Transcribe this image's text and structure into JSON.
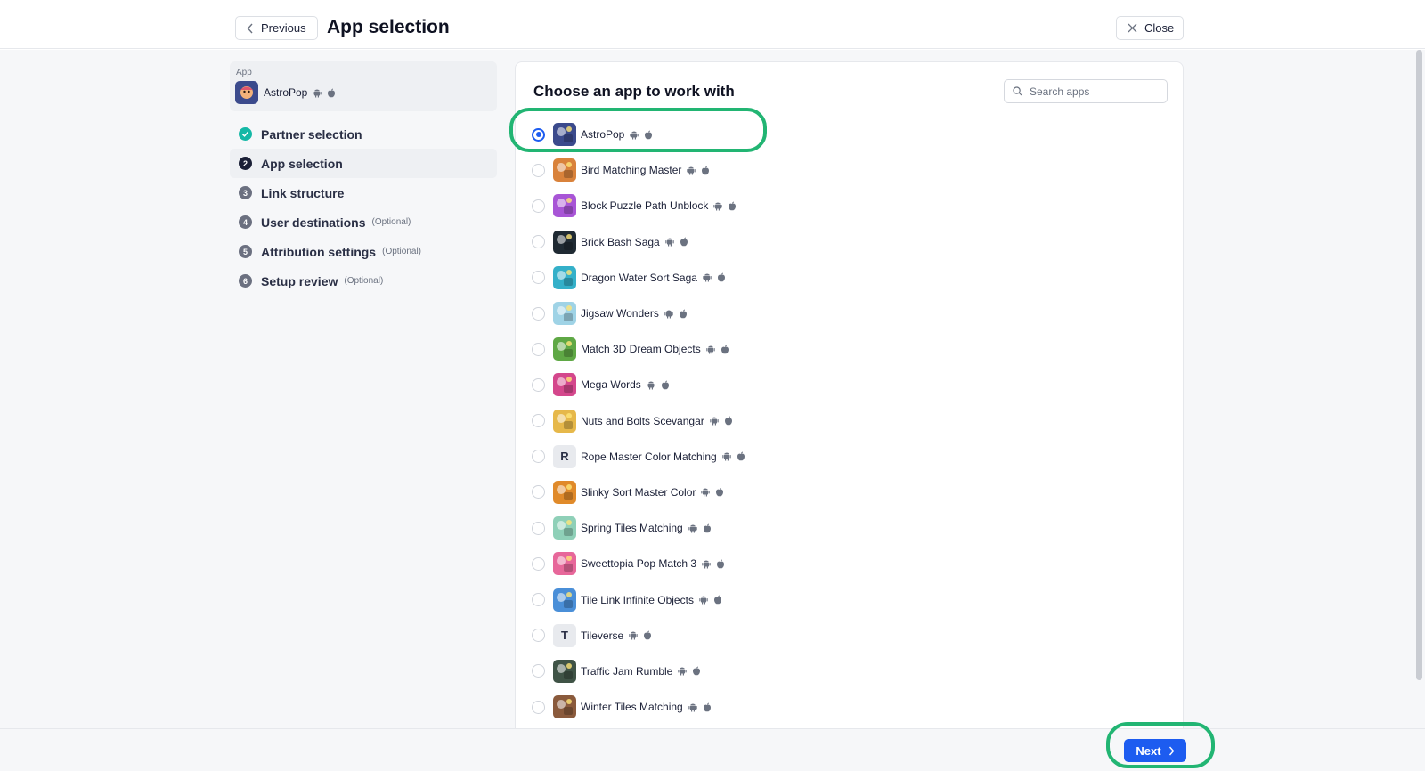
{
  "header": {
    "previous_label": "Previous",
    "title": "App selection",
    "close_label": "Close"
  },
  "sidebar": {
    "app_label": "App",
    "app_name": "AstroPop",
    "steps": [
      {
        "num": "1",
        "label": "Partner selection",
        "optional": "",
        "state": "done"
      },
      {
        "num": "2",
        "label": "App selection",
        "optional": "",
        "state": "active"
      },
      {
        "num": "3",
        "label": "Link structure",
        "optional": "",
        "state": "pending"
      },
      {
        "num": "4",
        "label": "User destinations",
        "optional": "(Optional)",
        "state": "pending"
      },
      {
        "num": "5",
        "label": "Attribution settings",
        "optional": "(Optional)",
        "state": "pending"
      },
      {
        "num": "6",
        "label": "Setup review",
        "optional": "(Optional)",
        "state": "pending"
      }
    ]
  },
  "main": {
    "title": "Choose an app to work with",
    "search_placeholder": "Search apps",
    "apps": [
      {
        "name": "AstroPop",
        "selected": true,
        "icon": "astropop-icon",
        "color": "#3b4a8c"
      },
      {
        "name": "Bird Matching Master",
        "selected": false,
        "icon": "bird-icon",
        "color": "#d9823b"
      },
      {
        "name": "Block Puzzle Path Unblock",
        "selected": false,
        "icon": "block-puzzle-icon",
        "color": "#a855d6"
      },
      {
        "name": "Brick Bash Saga",
        "selected": false,
        "icon": "brick-icon",
        "color": "#1f2a33"
      },
      {
        "name": "Dragon Water Sort Saga",
        "selected": false,
        "icon": "dragon-icon",
        "color": "#34b0c9"
      },
      {
        "name": "Jigsaw Wonders",
        "selected": false,
        "icon": "jigsaw-icon",
        "color": "#9fd3e6"
      },
      {
        "name": "Match 3D Dream Objects",
        "selected": false,
        "icon": "match3d-icon",
        "color": "#5fa845"
      },
      {
        "name": "Mega Words",
        "selected": false,
        "icon": "words-icon",
        "color": "#d4478c"
      },
      {
        "name": "Nuts and Bolts Scevangar",
        "selected": false,
        "icon": "nuts-icon",
        "color": "#e6b84a"
      },
      {
        "name": "Rope Master Color Matching",
        "selected": false,
        "icon": "letter-icon",
        "letter": "R",
        "color": "#e8eaee"
      },
      {
        "name": "Slinky Sort Master Color",
        "selected": false,
        "icon": "slinky-icon",
        "color": "#e08a2a"
      },
      {
        "name": "Spring Tiles Matching",
        "selected": false,
        "icon": "spring-icon",
        "color": "#8fd0b8"
      },
      {
        "name": "Sweettopia Pop Match 3",
        "selected": false,
        "icon": "sweet-icon",
        "color": "#e7679a"
      },
      {
        "name": "Tile Link Infinite Objects",
        "selected": false,
        "icon": "tile-link-icon",
        "color": "#4a8fd8"
      },
      {
        "name": "Tileverse",
        "selected": false,
        "icon": "letter-icon",
        "letter": "T",
        "color": "#e8eaee"
      },
      {
        "name": "Traffic Jam Rumble",
        "selected": false,
        "icon": "traffic-icon",
        "color": "#3f5346"
      },
      {
        "name": "Winter Tiles Matching",
        "selected": false,
        "icon": "winter-icon",
        "color": "#8a5a3c"
      }
    ]
  },
  "footer": {
    "next_label": "Next"
  },
  "colors": {
    "accent": "#1d5cf0",
    "done": "#14b8a6",
    "highlight": "#22b573"
  }
}
